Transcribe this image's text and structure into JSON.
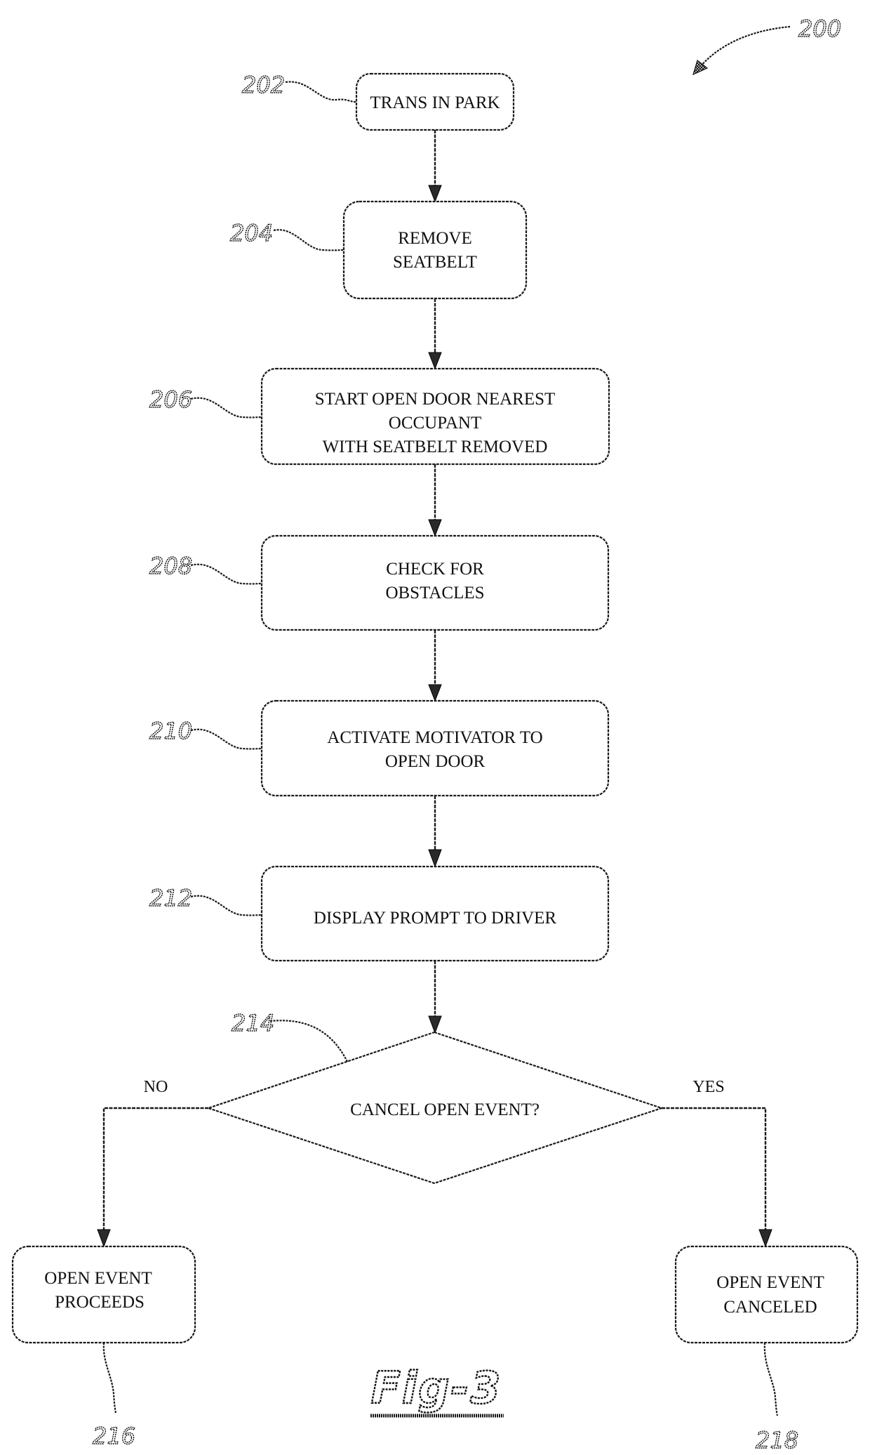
{
  "figure": {
    "ref": "200",
    "caption": "Fig-3"
  },
  "steps": [
    {
      "ref": "202",
      "lines": [
        "TRANS IN PARK"
      ]
    },
    {
      "ref": "204",
      "lines": [
        "REMOVE",
        "SEATBELT"
      ]
    },
    {
      "ref": "206",
      "lines": [
        "START OPEN DOOR NEAREST",
        "OCCUPANT",
        "WITH SEATBELT REMOVED"
      ]
    },
    {
      "ref": "208",
      "lines": [
        "CHECK FOR",
        "OBSTACLES"
      ]
    },
    {
      "ref": "210",
      "lines": [
        "ACTIVATE MOTIVATOR TO",
        "OPEN DOOR"
      ]
    },
    {
      "ref": "212",
      "lines": [
        "DISPLAY PROMPT TO DRIVER"
      ]
    }
  ],
  "decision": {
    "ref": "214",
    "question": "CANCEL OPEN EVENT?",
    "no_label": "NO",
    "yes_label": "YES"
  },
  "outcomes": {
    "no": {
      "ref": "216",
      "lines": [
        "OPEN EVENT",
        "PROCEEDS"
      ]
    },
    "yes": {
      "ref": "218",
      "lines": [
        "OPEN EVENT",
        "CANCELED"
      ]
    }
  }
}
